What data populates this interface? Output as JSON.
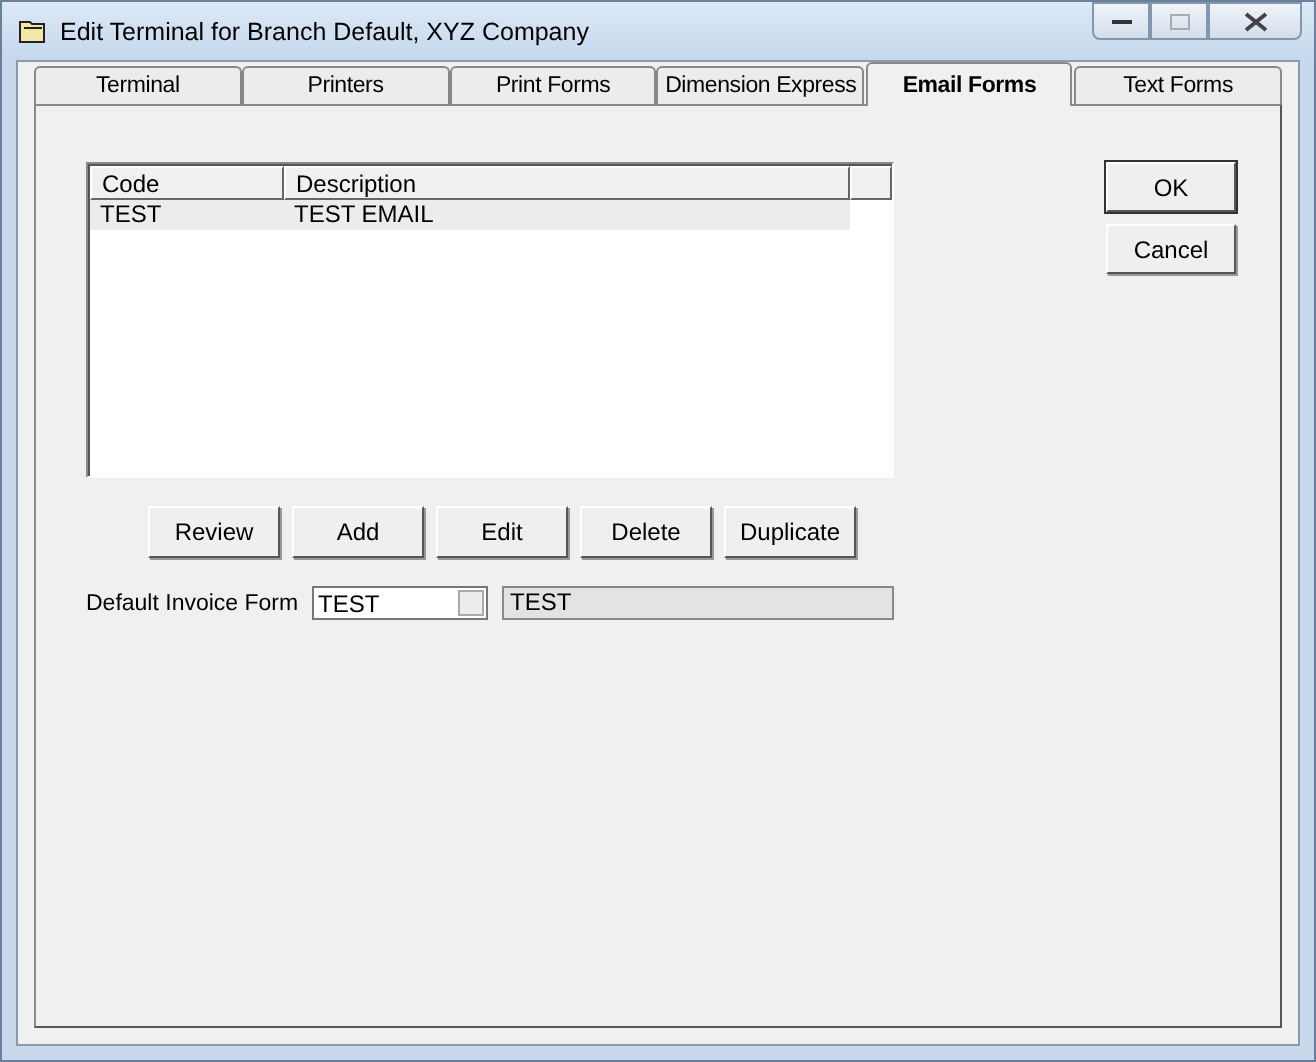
{
  "window": {
    "title": "Edit Terminal  for Branch Default, XYZ Company"
  },
  "tabs": [
    {
      "label": "Terminal",
      "selected": false
    },
    {
      "label": "Printers",
      "selected": false
    },
    {
      "label": "Print Forms",
      "selected": false
    },
    {
      "label": "Dimension Express",
      "selected": false
    },
    {
      "label": "Email Forms",
      "selected": true
    },
    {
      "label": "Text Forms",
      "selected": false
    }
  ],
  "list": {
    "columns": [
      "Code",
      "Description"
    ],
    "rows": [
      {
        "code": "TEST",
        "description": "TEST EMAIL",
        "selected": true
      }
    ]
  },
  "list_buttons": [
    "Review",
    "Add",
    "Edit",
    "Delete",
    "Duplicate"
  ],
  "default_invoice_form": {
    "label": "Default Invoice Form",
    "value": "TEST",
    "description": "TEST"
  },
  "dialog_buttons": [
    "OK",
    "Cancel"
  ]
}
